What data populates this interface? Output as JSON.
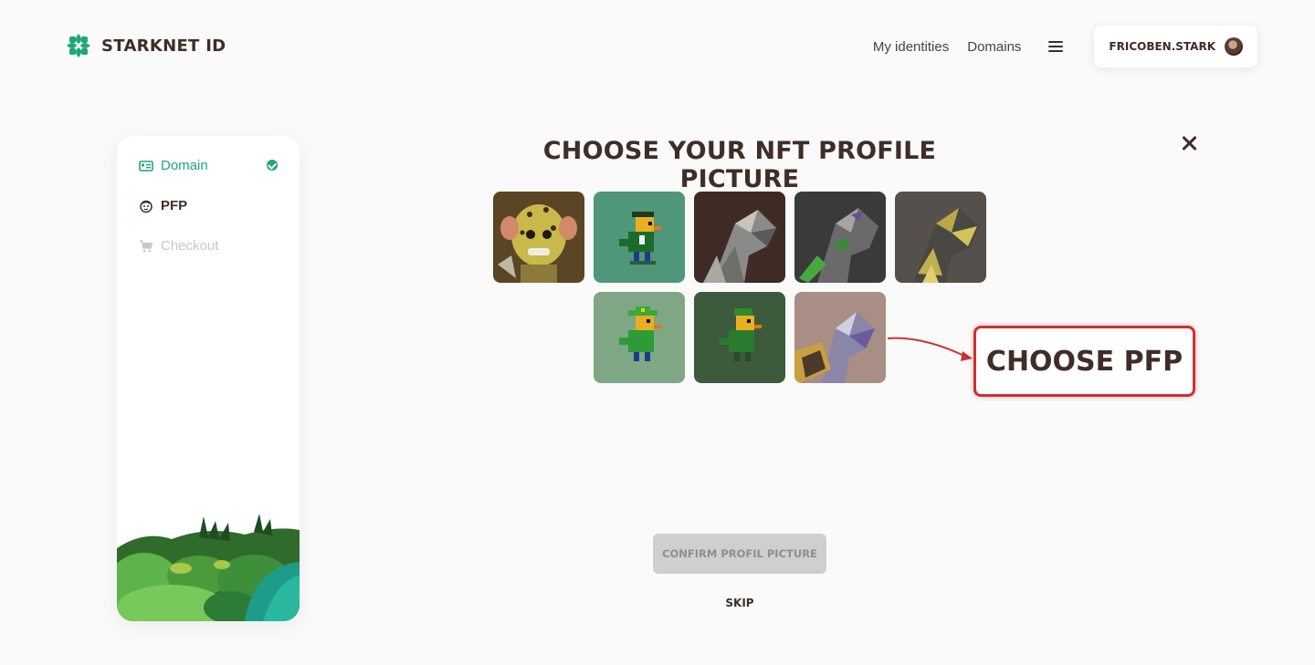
{
  "header": {
    "brand": "STARKNET ID",
    "nav": [
      "My identities",
      "Domains"
    ],
    "account_name": "FRICOBEN.STARK",
    "menu_icon": "hamburger-menu-icon"
  },
  "sidebar": {
    "steps": [
      {
        "label": "Domain",
        "icon": "domain-card-icon",
        "status": "done"
      },
      {
        "label": "PFP",
        "icon": "monkey-face-icon",
        "status": "active"
      },
      {
        "label": "Checkout",
        "icon": "cart-icon",
        "status": "disabled"
      }
    ]
  },
  "main": {
    "title": "CHOOSE YOUR NFT PROFILE PICTURE",
    "nfts": [
      {
        "name": "leopard-monkey"
      },
      {
        "name": "pixel-duck-black-hat"
      },
      {
        "name": "low-poly-dragon-grey"
      },
      {
        "name": "low-poly-dragon-green"
      },
      {
        "name": "low-poly-dragon-gold"
      },
      {
        "name": "pixel-duck-green-hat"
      },
      {
        "name": "pixel-duck-green-dark"
      },
      {
        "name": "low-poly-dragon-purple"
      }
    ],
    "annotation": "CHOOSE PFP",
    "confirm_label": "CONFIRM PROFIL PICTURE",
    "skip_label": "SKIP"
  },
  "colors": {
    "accent": "#1fa67a",
    "brown": "#402d28",
    "annotation_red": "#cf3030",
    "disabled_button": "#cfcfcf"
  }
}
